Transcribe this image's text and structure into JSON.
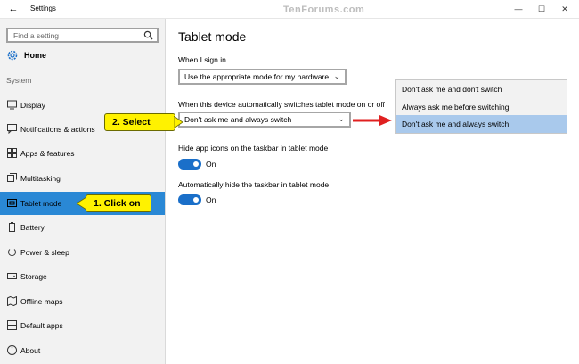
{
  "window": {
    "title": "Settings",
    "watermark": "TenForums.com",
    "controls": [
      "—",
      "☐",
      "✕"
    ]
  },
  "sidebar": {
    "search_placeholder": "Find a setting",
    "home_label": "Home",
    "group_label": "System",
    "items": [
      {
        "label": "Display",
        "icon": "display-icon"
      },
      {
        "label": "Notifications & actions",
        "icon": "notifications-icon"
      },
      {
        "label": "Apps & features",
        "icon": "apps-icon"
      },
      {
        "label": "Multitasking",
        "icon": "multitasking-icon"
      },
      {
        "label": "Tablet mode",
        "icon": "tablet-icon",
        "active": true
      },
      {
        "label": "Battery",
        "icon": "battery-icon"
      },
      {
        "label": "Power & sleep",
        "icon": "power-icon"
      },
      {
        "label": "Storage",
        "icon": "storage-icon"
      },
      {
        "label": "Offline maps",
        "icon": "maps-icon"
      },
      {
        "label": "Default apps",
        "icon": "default-apps-icon"
      },
      {
        "label": "About",
        "icon": "info-icon"
      }
    ]
  },
  "main": {
    "title": "Tablet mode",
    "signin_label": "When I sign in",
    "signin_value": "Use the appropriate mode for my hardware",
    "switch_label": "When this device automatically switches tablet mode on or off",
    "switch_value": "Don't ask me and always switch",
    "hide_icons_label": "Hide app icons on the taskbar in tablet mode",
    "hide_icons_state": "On",
    "hide_taskbar_label": "Automatically hide the taskbar in tablet mode",
    "hide_taskbar_state": "On"
  },
  "dropdown": {
    "options": [
      "Don't ask me and don't switch",
      "Always ask me before switching",
      "Don't ask me and always switch"
    ],
    "selected_index": 2
  },
  "callouts": {
    "select": "2. Select",
    "click": "1. Click on"
  },
  "colors": {
    "accent": "#2a88d5",
    "toggle_on": "#1a6fc9",
    "callout_fill": "#fff200",
    "arrow": "#e02020",
    "selected_option": "#a9c9ec"
  }
}
